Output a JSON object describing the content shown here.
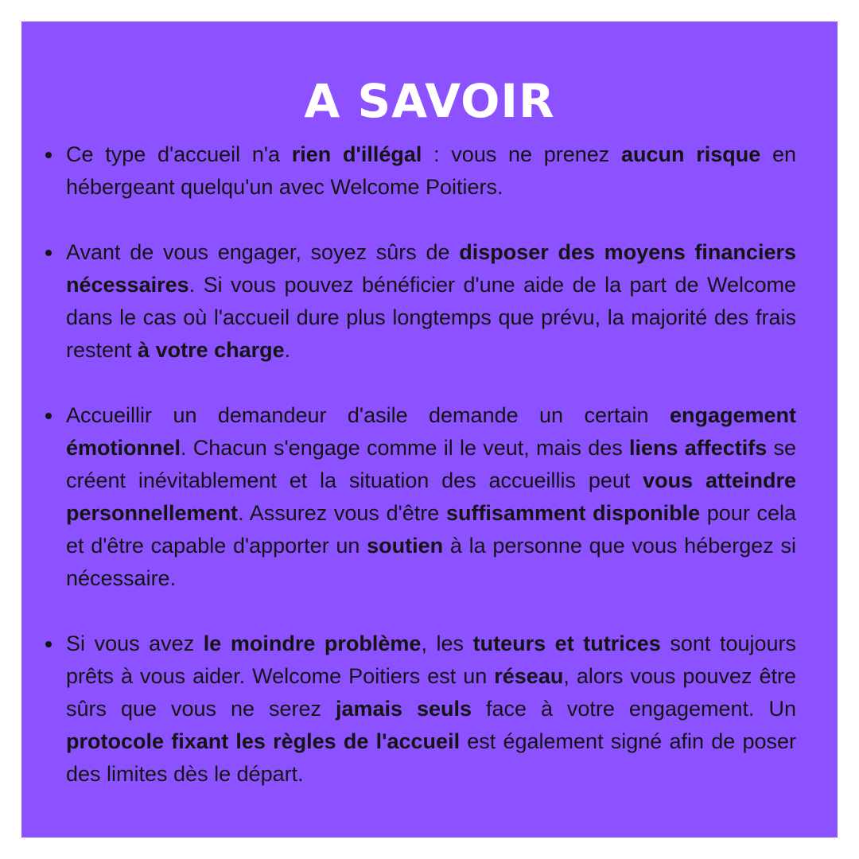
{
  "background_color": "#ffffff",
  "card_color": "#8c52ff",
  "title": "A SAVOIR",
  "items": [
    {
      "segments": [
        {
          "text": "Ce type d'accueil n'a ",
          "bold": false
        },
        {
          "text": "rien d'illégal",
          "bold": true
        },
        {
          "text": " : vous ne prenez ",
          "bold": false
        },
        {
          "text": "aucun risque",
          "bold": true
        },
        {
          "text": " en hébergeant quelqu'un avec Welcome Poitiers.",
          "bold": false
        }
      ]
    },
    {
      "segments": [
        {
          "text": "Avant de vous engager, soyez sûrs de ",
          "bold": false
        },
        {
          "text": "disposer des moyens financiers nécessaires",
          "bold": true
        },
        {
          "text": ". Si vous pouvez bénéficier d'une aide de la part de Welcome dans le cas où l'accueil dure plus longtemps que prévu, la majorité des frais restent ",
          "bold": false
        },
        {
          "text": "à votre charge",
          "bold": true
        },
        {
          "text": ".",
          "bold": false
        }
      ]
    },
    {
      "segments": [
        {
          "text": "Accueillir un demandeur d'asile demande un certain ",
          "bold": false
        },
        {
          "text": "engagement émotionnel",
          "bold": true
        },
        {
          "text": ". Chacun s'engage comme il le veut, mais des ",
          "bold": false
        },
        {
          "text": "liens affectifs",
          "bold": true
        },
        {
          "text": " se créent inévitablement et la situation des accueillis peut ",
          "bold": false
        },
        {
          "text": "vous atteindre personnellement",
          "bold": true
        },
        {
          "text": ". Assurez vous d'être ",
          "bold": false
        },
        {
          "text": "suffisamment disponible",
          "bold": true
        },
        {
          "text": " pour cela et d'être capable d'apporter un ",
          "bold": false
        },
        {
          "text": "soutien",
          "bold": true
        },
        {
          "text": " à la personne que vous hébergez si nécessaire.",
          "bold": false
        }
      ]
    },
    {
      "segments": [
        {
          "text": "Si vous avez ",
          "bold": false
        },
        {
          "text": "le moindre problème",
          "bold": true
        },
        {
          "text": ", les ",
          "bold": false
        },
        {
          "text": "tuteurs et tutrices",
          "bold": true
        },
        {
          "text": " sont toujours prêts à vous aider. Welcome Poitiers est un ",
          "bold": false
        },
        {
          "text": "réseau",
          "bold": true
        },
        {
          "text": ", alors vous pouvez être sûrs que vous ne serez ",
          "bold": false
        },
        {
          "text": "jamais seuls",
          "bold": true
        },
        {
          "text": " face à votre engagement. Un ",
          "bold": false
        },
        {
          "text": "protocole fixant les règles de l'accueil",
          "bold": true
        },
        {
          "text": " est également signé afin de poser des limites dès le départ.",
          "bold": false
        }
      ]
    }
  ]
}
